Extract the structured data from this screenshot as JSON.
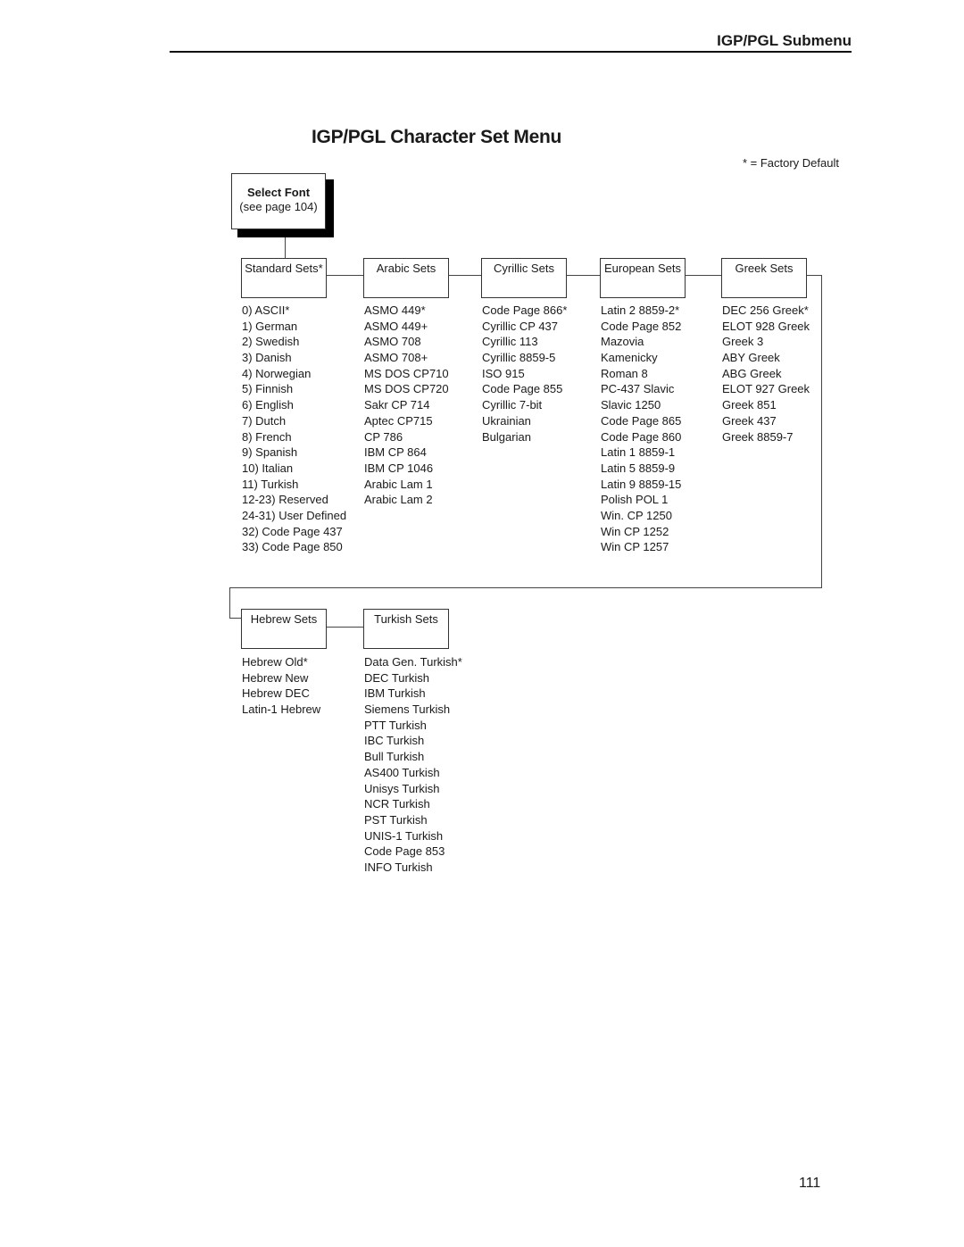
{
  "header": {
    "section_title": "IGP/PGL Submenu"
  },
  "page_title": "IGP/PGL Character Set Menu",
  "legend": "* = Factory Default",
  "select_font": {
    "title": "Select Font",
    "ref": "(see page 104)"
  },
  "groups_row1": [
    {
      "label": "Standard Sets*",
      "items": [
        "0) ASCII*",
        "1) German",
        "2) Swedish",
        "3) Danish",
        "4) Norwegian",
        "5) Finnish",
        "6) English",
        "7) Dutch",
        "8) French",
        "9) Spanish",
        "10) Italian",
        "11) Turkish",
        "12-23) Reserved",
        "24-31) User Defined",
        "32) Code Page 437",
        "33) Code Page 850"
      ]
    },
    {
      "label": "Arabic Sets",
      "items": [
        "ASMO 449*",
        "ASMO 449+",
        "ASMO 708",
        "ASMO 708+",
        "MS DOS CP710",
        "MS DOS CP720",
        "Sakr CP 714",
        "Aptec CP715",
        "CP 786",
        "IBM CP 864",
        "IBM CP 1046",
        "Arabic Lam 1",
        "Arabic Lam 2"
      ]
    },
    {
      "label": "Cyrillic Sets",
      "items": [
        "Code Page 866*",
        "Cyrillic CP 437",
        "Cyrillic 113",
        "Cyrillic 8859-5",
        "ISO 915",
        "Code Page 855",
        "Cyrillic 7-bit",
        "Ukrainian",
        "Bulgarian"
      ]
    },
    {
      "label": "European Sets",
      "items": [
        "Latin 2 8859-2*",
        "Code Page 852",
        "Mazovia",
        "Kamenicky",
        "Roman 8",
        "PC-437 Slavic",
        "Slavic 1250",
        "Code Page 865",
        "Code Page 860",
        "Latin 1 8859-1",
        "Latin 5 8859-9",
        "Latin 9 8859-15",
        "Polish POL 1",
        "Win. CP 1250",
        "Win CP 1252",
        "Win CP 1257"
      ]
    },
    {
      "label": "Greek Sets",
      "items": [
        "DEC 256 Greek*",
        "ELOT 928 Greek",
        "Greek 3",
        "ABY Greek",
        "ABG Greek",
        "ELOT 927 Greek",
        "Greek 851",
        "Greek 437",
        "Greek 8859-7"
      ]
    }
  ],
  "groups_row2": [
    {
      "label": "Hebrew Sets",
      "items": [
        "Hebrew Old*",
        "Hebrew New",
        "Hebrew DEC",
        "Latin-1 Hebrew"
      ]
    },
    {
      "label": "Turkish Sets",
      "items": [
        "Data Gen. Turkish*",
        "DEC Turkish",
        "IBM Turkish",
        "Siemens Turkish",
        "PTT Turkish",
        "IBC Turkish",
        "Bull Turkish",
        "AS400 Turkish",
        "Unisys Turkish",
        "NCR Turkish",
        "PST Turkish",
        "UNIS-1 Turkish",
        "Code Page 853",
        "INFO Turkish"
      ]
    }
  ],
  "page_number": "111"
}
